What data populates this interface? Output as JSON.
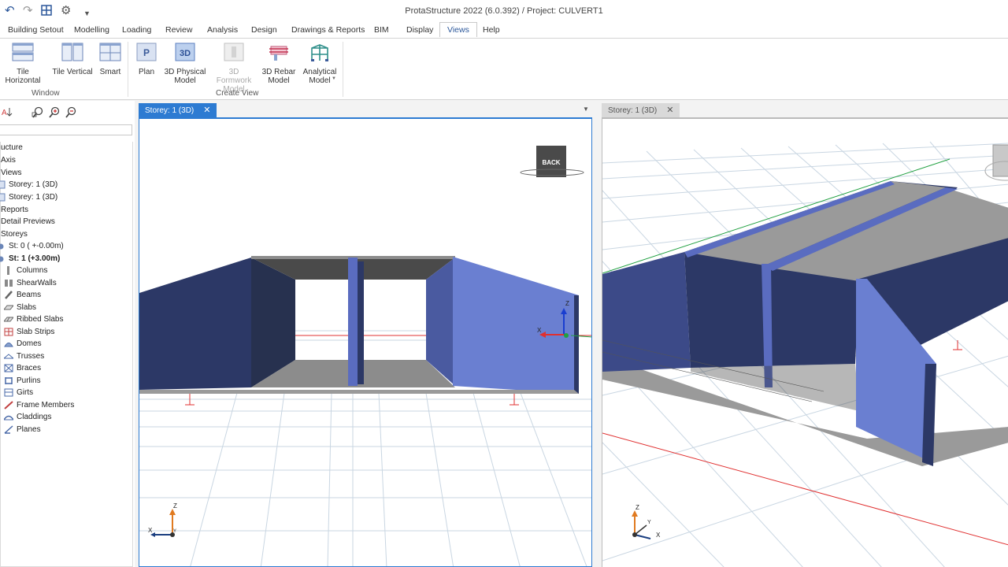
{
  "window": {
    "title": "ProtaStructure 2022 (6.0.392) / Project: CULVERT1"
  },
  "menu": [
    "Building Setout",
    "Modelling",
    "Loading",
    "Review",
    "Analysis",
    "Design",
    "Drawings & Reports",
    "BIM",
    "Display",
    "Views",
    "Help"
  ],
  "menu_active": "Views",
  "ribbon": {
    "tile_horizontal": "Tile Horizontal",
    "tile_vertical": "Tile Vertical",
    "smart": "Smart",
    "group_window": "Window",
    "plan": "Plan",
    "physical_1": "3D Physical",
    "physical_2": "Model",
    "formwork_1": "3D Formwork",
    "formwork_2": "Model",
    "rebar_1": "3D Rebar",
    "rebar_2": "Model",
    "analytical_1": "Analytical",
    "analytical_2": "Model",
    "group_create_view": "Create View",
    "plan_icon_text": "P",
    "physical_icon_text": "3D"
  },
  "tree": {
    "structure": "ucture",
    "axis": "Axis",
    "views": "Views",
    "view1": "Storey: 1 (3D)",
    "view2": "Storey: 1 (3D)",
    "reports": "Reports",
    "detail_previews": "Detail Previews",
    "storeys": "Storeys",
    "st0": "St: 0 ( +-0.00m)",
    "st1": "St: 1 (+3.00m)",
    "items": [
      "Columns",
      "ShearWalls",
      "Beams",
      "Slabs",
      "Ribbed Slabs",
      "Slab Strips",
      "Domes",
      "Trusses",
      "Braces",
      "Purlins",
      "Girts",
      "Frame Members",
      "Claddings",
      "Planes"
    ]
  },
  "viewports": {
    "left_tab": "Storey: 1 (3D)",
    "right_tab": "Storey: 1 (3D)",
    "close": "✕",
    "view_cube_label": "BACK",
    "axis_x": "X",
    "axis_y": "Y",
    "axis_z": "Z"
  },
  "colors": {
    "accent": "#2b579a",
    "tab_active": "#2d7bd2",
    "wall_light": "#6a7fd1",
    "wall_dark": "#2c3866",
    "slab": "#9a9a9a"
  }
}
